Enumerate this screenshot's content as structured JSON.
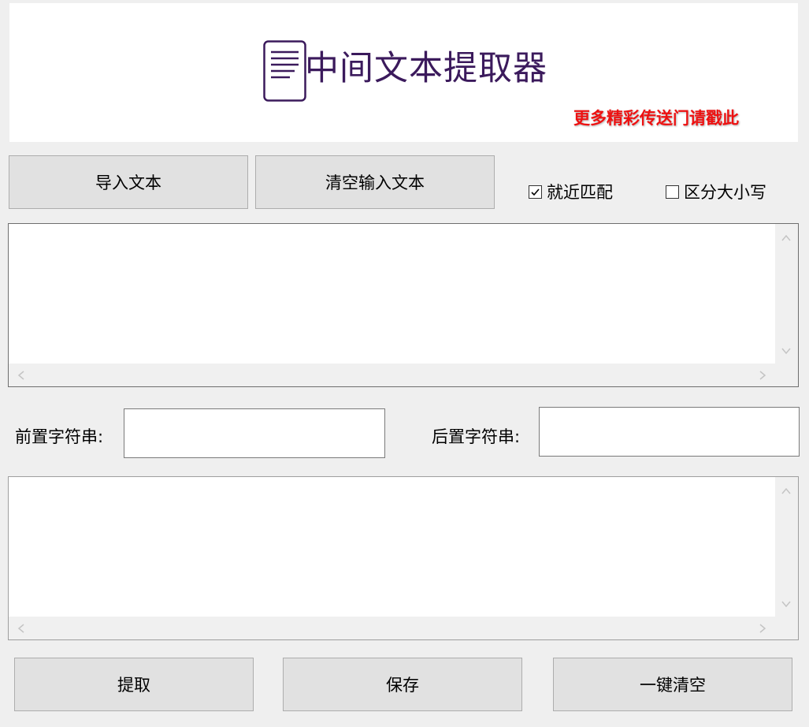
{
  "header": {
    "title": "中间文本提取器",
    "logo_icon": "document-lines-icon",
    "promo_link": "更多精彩传送门请戳此",
    "title_color": "#3b1a5c",
    "promo_color": "#ee1111"
  },
  "toolbar": {
    "import_label": "导入文本",
    "clear_input_label": "清空输入文本"
  },
  "options": {
    "nearest_match": {
      "label": "就近匹配",
      "checked": true
    },
    "case_sensitive": {
      "label": "区分大小写",
      "checked": false
    }
  },
  "input_text": {
    "value": ""
  },
  "prefix": {
    "label": "前置字符串:",
    "value": ""
  },
  "suffix": {
    "label": "后置字符串:",
    "value": ""
  },
  "output_text": {
    "value": ""
  },
  "actions": {
    "extract_label": "提取",
    "save_label": "保存",
    "clear_all_label": "一键清空"
  }
}
